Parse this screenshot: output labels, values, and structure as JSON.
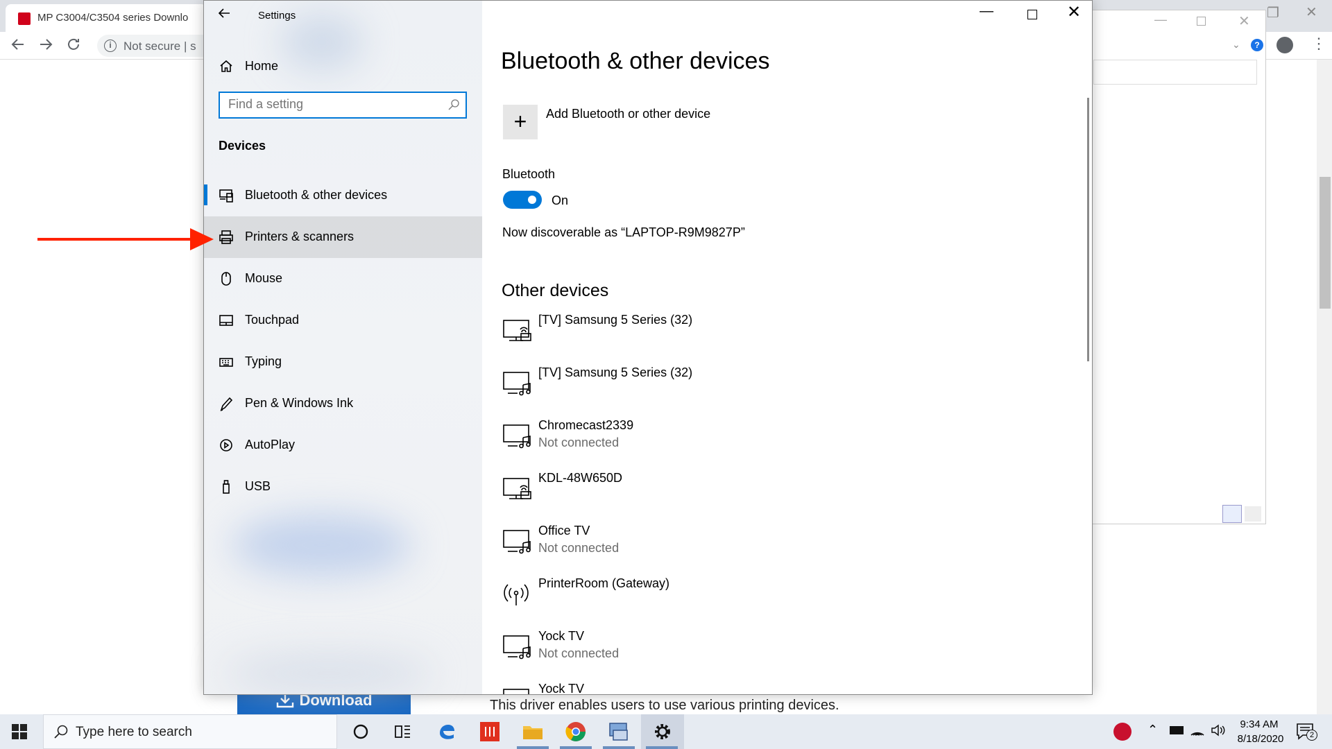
{
  "browser": {
    "tab_title": "MP C3004/C3504 series Downlo",
    "back_icon": "arrow-left-icon",
    "forward_icon": "arrow-right-icon",
    "reload_icon": "reload-icon",
    "security_label": "Not secure",
    "url_fragment": "|  s",
    "help_badge": "?",
    "download_button_label": "Download",
    "driver_description": "This driver enables users to use various printing devices."
  },
  "settings": {
    "window_title": "Settings",
    "home_label": "Home",
    "search_placeholder": "Find a setting",
    "section_heading": "Devices",
    "nav_items": [
      {
        "label": "Bluetooth & other devices",
        "icon": "bluetooth-devices-icon",
        "selected": true
      },
      {
        "label": "Printers & scanners",
        "icon": "printer-icon",
        "selected": false
      },
      {
        "label": "Mouse",
        "icon": "mouse-icon",
        "selected": false
      },
      {
        "label": "Touchpad",
        "icon": "touchpad-icon",
        "selected": false
      },
      {
        "label": "Typing",
        "icon": "keyboard-icon",
        "selected": false
      },
      {
        "label": "Pen & Windows Ink",
        "icon": "pen-icon",
        "selected": false
      },
      {
        "label": "AutoPlay",
        "icon": "autoplay-icon",
        "selected": false
      },
      {
        "label": "USB",
        "icon": "usb-icon",
        "selected": false
      }
    ]
  },
  "content": {
    "page_title": "Bluetooth & other devices",
    "add_device_label": "Add Bluetooth or other device",
    "add_device_glyph": "+",
    "bluetooth_label": "Bluetooth",
    "bluetooth_state": "On",
    "bluetooth_on": true,
    "discoverable_text": "Now discoverable as “LAPTOP-R9M9827P”",
    "other_devices_heading": "Other devices",
    "devices": [
      {
        "name": "[TV] Samsung 5 Series (32)",
        "status": "",
        "icon": "display-icon"
      },
      {
        "name": "[TV] Samsung 5 Series (32)",
        "status": "",
        "icon": "media-display-icon"
      },
      {
        "name": "Chromecast2339",
        "status": "Not connected",
        "icon": "media-display-icon"
      },
      {
        "name": "KDL-48W650D",
        "status": "",
        "icon": "display-icon"
      },
      {
        "name": "Office TV",
        "status": "Not connected",
        "icon": "media-display-icon"
      },
      {
        "name": "PrinterRoom (Gateway)",
        "status": "",
        "icon": "wireless-gateway-icon"
      },
      {
        "name": "Yock TV",
        "status": "Not connected",
        "icon": "media-display-icon"
      },
      {
        "name": "Yock TV",
        "status": "",
        "icon": "display-icon"
      }
    ]
  },
  "taskbar": {
    "search_placeholder": "Type here to search",
    "time": "9:34 AM",
    "date": "8/18/2020",
    "notification_count": "2",
    "pinned_apps": [
      "cortana-icon",
      "task-view-icon",
      "edge-icon",
      "office-icon",
      "file-explorer-icon",
      "chrome-icon",
      "remote-app-icon",
      "settings-gear-icon"
    ]
  },
  "colors": {
    "accent": "#0078d7",
    "annotation_arrow": "#ff2200",
    "download_button": "#1565c0"
  }
}
